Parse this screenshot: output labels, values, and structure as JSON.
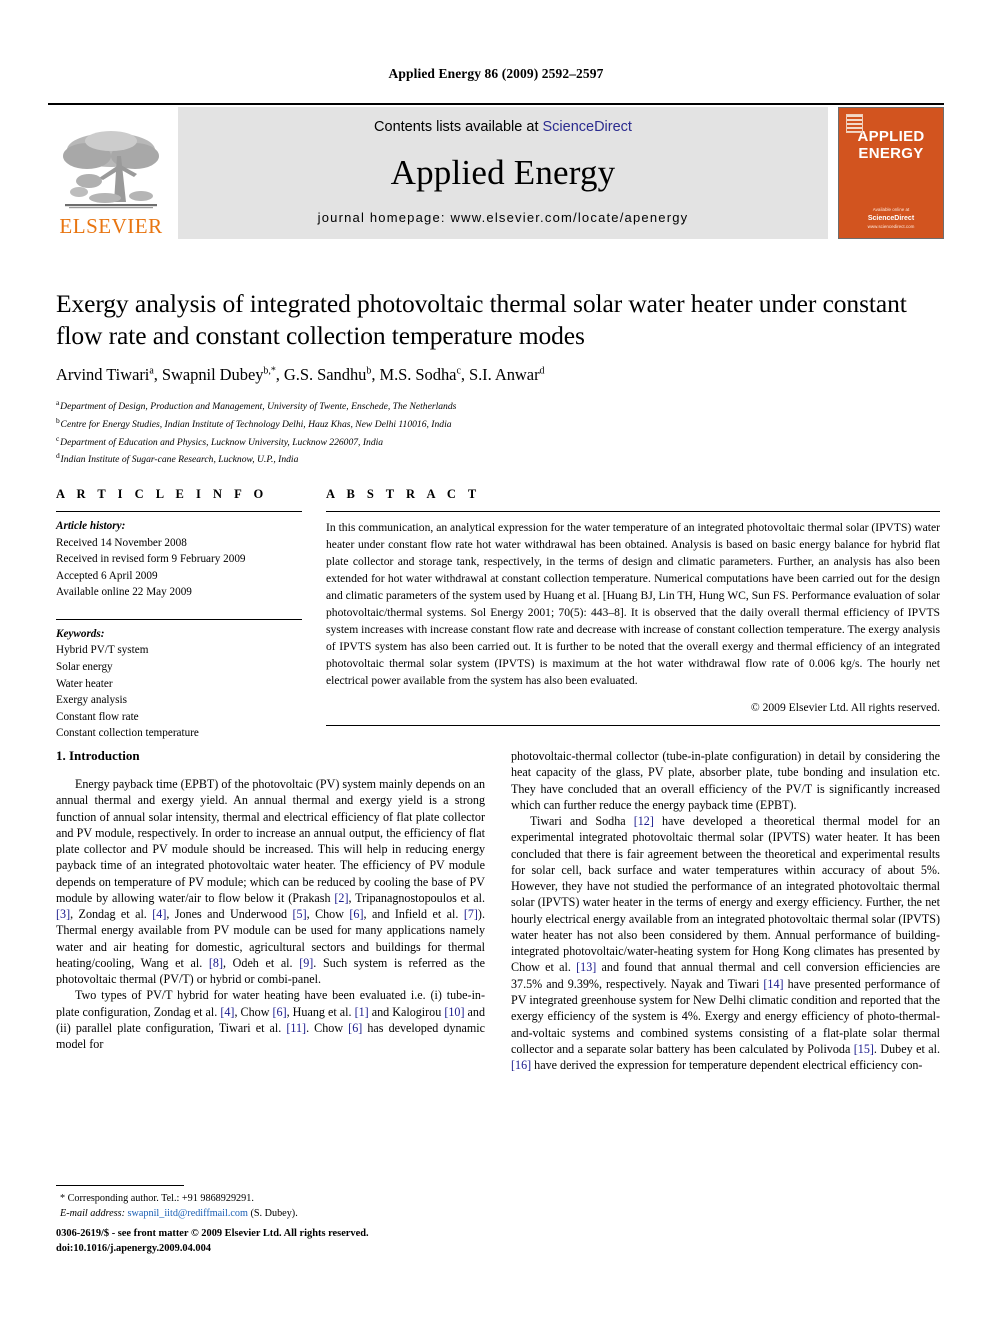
{
  "running_head": "Applied Energy 86 (2009) 2592–2597",
  "masthead": {
    "contents_prefix": "Contents lists available at ",
    "sciencedirect": "ScienceDirect",
    "journal_title": "Applied Energy",
    "homepage": "journal homepage: www.elsevier.com/locate/apenergy",
    "elsevier_wordmark": "ELSEVIER",
    "cover_title_line1": "APPLIED",
    "cover_title_line2": "ENERGY",
    "cover_footer_top": "Available online at",
    "cover_footer_sd": "ScienceDirect",
    "cover_footer_url": "www.sciencedirect.com",
    "accent_orange": "#e87511",
    "cover_orange": "#d2541f",
    "link_blue": "#2b2b8f"
  },
  "title": "Exergy analysis of integrated photovoltaic thermal solar water heater under constant flow rate and constant collection temperature modes",
  "authors": "Arvind Tiwari a, Swapnil Dubey b,*, G.S. Sandhu b, M.S. Sodha c, S.I. Anwar d",
  "affiliations": [
    "a Department of Design, Production and Management, University of Twente, Enschede, The Netherlands",
    "b Centre for Energy Studies, Indian Institute of Technology Delhi, Hauz Khas, New Delhi 110016, India",
    "c Department of Education and Physics, Lucknow University, Lucknow 226007, India",
    "d Indian Institute of Sugar-cane Research, Lucknow, U.P., India"
  ],
  "article_info": {
    "label": "A R T I C L E   I N F O",
    "history_heading": "Article history:",
    "history": [
      "Received 14 November 2008",
      "Received in revised form 9 February 2009",
      "Accepted 6 April 2009",
      "Available online 22 May 2009"
    ],
    "keywords_heading": "Keywords:",
    "keywords": [
      "Hybrid PV/T system",
      "Solar energy",
      "Water heater",
      "Exergy analysis",
      "Constant flow rate",
      "Constant collection temperature"
    ]
  },
  "abstract": {
    "label": "A B S T R A C T",
    "text": "In this communication, an analytical expression for the water temperature of an integrated photovoltaic thermal solar (IPVTS) water heater under constant flow rate hot water withdrawal has been obtained. Analysis is based on basic energy balance for hybrid flat plate collector and storage tank, respectively, in the terms of design and climatic parameters. Further, an analysis has also been extended for hot water withdrawal at constant collection temperature. Numerical computations have been carried out for the design and climatic parameters of the system used by Huang et al. [Huang BJ, Lin TH, Hung WC, Sun FS. Performance evaluation of solar photovoltaic/thermal systems. Sol Energy 2001; 70(5): 443–8]. It is observed that the daily overall thermal efficiency of IPVTS system increases with increase constant flow rate and decrease with increase of constant collection temperature. The exergy analysis of IPVTS system has also been carried out. It is further to be noted that the overall exergy and thermal efficiency of an integrated photovoltaic thermal solar system (IPVTS) is maximum at the hot water withdrawal flow rate of 0.006 kg/s. The hourly net electrical power available from the system has also been evaluated.",
    "copyright": "© 2009 Elsevier Ltd. All rights reserved."
  },
  "body": {
    "section_title": "1. Introduction",
    "left_paragraphs": [
      "Energy payback time (EPBT) of the photovoltaic (PV) system mainly depends on an annual thermal and exergy yield. An annual thermal and exergy yield is a strong function of annual solar intensity, thermal and electrical efficiency of flat plate collector and PV module, respectively. In order to increase an annual output, the efficiency of flat plate collector and PV module should be increased. This will help in reducing energy payback time of an integrated photovoltaic water heater. The efficiency of PV module depends on temperature of PV module; which can be reduced by cooling the base of PV module by allowing water/air to flow below it (Prakash [2], Tripanagnostopoulos et al. [3], Zondag et al. [4], Jones and Underwood [5], Chow [6], and Infield et al. [7]). Thermal energy available from PV module can be used for many applications namely water and air heating for domestic, agricultural sectors and buildings for thermal heating/cooling, Wang et al. [8], Odeh et al. [9]. Such system is referred as the photovoltaic thermal (PV/T) or hybrid or combi-panel.",
      "Two types of PV/T hybrid for water heating have been evaluated i.e. (i) tube-in-plate configuration, Zondag et al. [4], Chow [6], Huang et al. [1] and Kalogirou [10] and (ii) parallel plate configuration, Tiwari et al. [11]. Chow [6] has developed dynamic model for"
    ],
    "right_paragraphs": [
      "photovoltaic-thermal collector (tube-in-plate configuration) in detail by considering the heat capacity of the glass, PV plate, absorber plate, tube bonding and insulation etc. They have concluded that an overall efficiency of the PV/T is significantly increased which can further reduce the energy payback time (EPBT).",
      "Tiwari and Sodha [12] have developed a theoretical thermal model for an experimental integrated photovoltaic thermal solar (IPVTS) water heater. It has been concluded that there is fair agreement between the theoretical and experimental results for solar cell, back surface and water temperatures within accuracy of about 5%. However, they have not studied the performance of an integrated photovoltaic thermal solar (IPVTS) water heater in the terms of energy and exergy efficiency. Further, the net hourly electrical energy available from an integrated photovoltaic thermal solar (IPVTS) water heater has not also been considered by them. Annual performance of building-integrated photovoltaic/water-heating system for Hong Kong climates has presented by Chow et al. [13] and found that annual thermal and cell conversion efficiencies are 37.5% and 9.39%, respectively. Nayak and Tiwari [14] have presented performance of PV integrated greenhouse system for New Delhi climatic condition and reported that the exergy efficiency of the system is 4%. Exergy and energy efficiency of photo-thermal-and-voltaic systems and combined systems consisting of a flat-plate solar thermal collector and a separate solar battery has been calculated by Polivoda [15]. Dubey et al. [16] have derived the expression for temperature dependent electrical efficiency con-"
    ]
  },
  "footnote": {
    "corresponding": "* Corresponding author. Tel.: +91 9868929291.",
    "email_label": "E-mail address:",
    "email": "swapnil_iitd@rediffmail.com",
    "email_suffix": "(S. Dubey)."
  },
  "page_footer": {
    "line1": "0306-2619/$ - see front matter © 2009 Elsevier Ltd. All rights reserved.",
    "line2": "doi:10.1016/j.apenergy.2009.04.004"
  }
}
